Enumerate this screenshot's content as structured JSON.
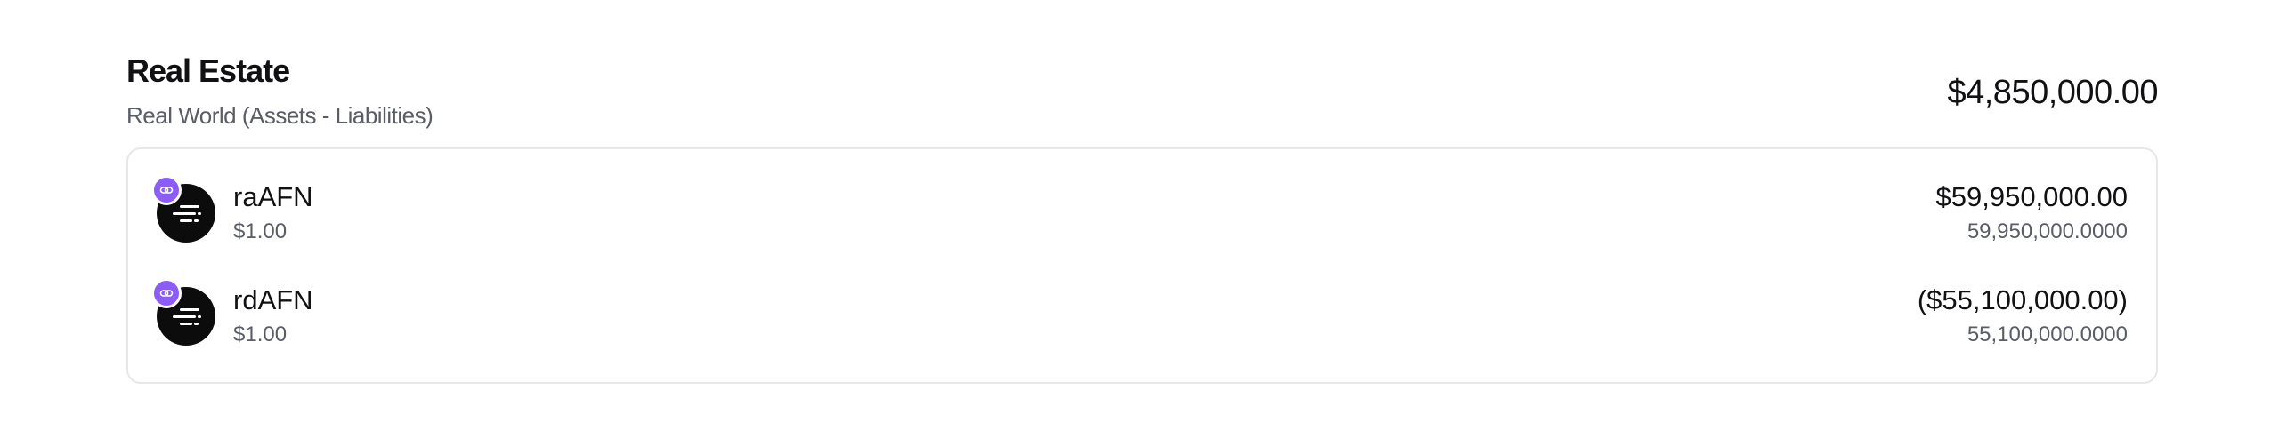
{
  "section": {
    "title": "Real Estate",
    "subtitle": "Real World (Assets - Liabilities)",
    "total": "$4,850,000.00"
  },
  "rows": [
    {
      "icon": "token-logo-icon",
      "badge_icon": "link-chain-icon",
      "badge_color": "#8b5cf6",
      "name": "raAFN",
      "price": "$1.00",
      "value": "$59,950,000.00",
      "amount": "59,950,000.0000"
    },
    {
      "icon": "token-logo-icon",
      "badge_icon": "link-chain-icon",
      "badge_color": "#8b5cf6",
      "name": "rdAFN",
      "price": "$1.00",
      "value": "($55,100,000.00)",
      "amount": "55,100,000.0000"
    }
  ]
}
